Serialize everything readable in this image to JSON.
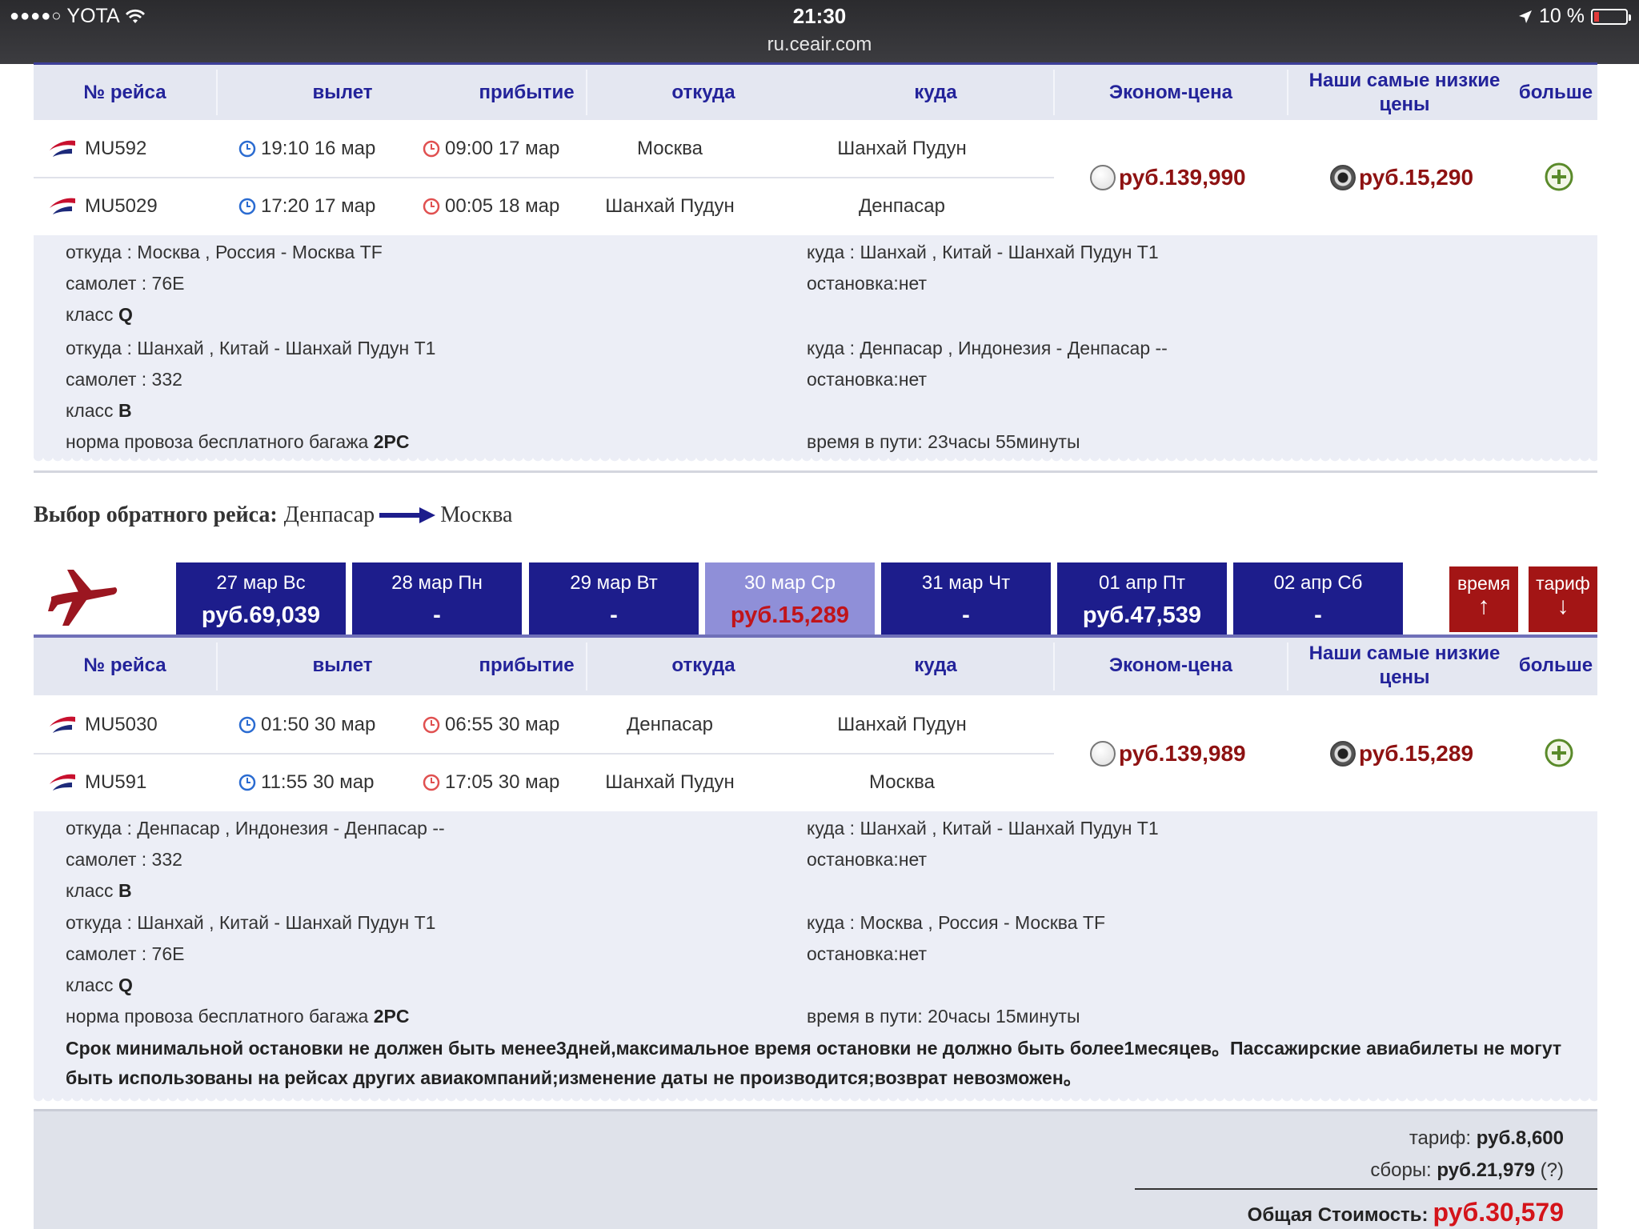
{
  "status": {
    "carrier": "YOTA",
    "time": "21:30",
    "url": "ru.ceair.com",
    "battery": "10 %"
  },
  "colors": {
    "accent": "#1d1d8c",
    "price_red": "#8e1212",
    "total_red": "#d4141a",
    "header_text": "#23239a"
  },
  "table_header": {
    "flight": "№ рейса",
    "depart": "вылет",
    "arrive": "прибытие",
    "from": "откуда",
    "to": "куда",
    "economy": "Эконом-цена",
    "lowest": "Наши самые низкие цены",
    "more": "больше"
  },
  "outbound": {
    "flights": [
      {
        "no": "MU592",
        "dep": "19:10 16 мар",
        "arr": "09:00 17 мар",
        "from": "Москва",
        "to": "Шанхай Пудун"
      },
      {
        "no": "MU5029",
        "dep": "17:20 17 мар",
        "arr": "00:05 18 мар",
        "from": "Шанхай Пудун",
        "to": "Денпасар"
      }
    ],
    "economy_price": "руб.139,990",
    "lowest_price": "руб.15,290",
    "details": {
      "l1": "откуда : Москва , Россия - Москва TF",
      "r1": "куда : Шанхай , Китай - Шанхай Пудун T1",
      "l2": "самолет : 76E",
      "r2": "остановка:нет",
      "l3": "класс",
      "l3v": "Q",
      "l4": "откуда : Шанхай , Китай - Шанхай Пудун T1",
      "r4": "куда : Денпасар , Индонезия - Денпасар --",
      "l5": "самолет : 332",
      "r5": "остановка:нет",
      "l6": "класс",
      "l6v": "B",
      "l7": "норма провоза бесплатного багажа",
      "l7v": "2PC",
      "r7": "время в пути: 23часы 55минуты"
    }
  },
  "return_title": {
    "label": "Выбор обратного рейса:",
    "from": "Денпасар",
    "to": "Москва"
  },
  "dates": [
    {
      "day": "27 мар Вс",
      "price": "руб.69,039"
    },
    {
      "day": "28 мар Пн",
      "price": "-"
    },
    {
      "day": "29 мар Вт",
      "price": "-"
    },
    {
      "day": "30 мар Ср",
      "price": "руб.15,289"
    },
    {
      "day": "31 мар Чт",
      "price": "-"
    },
    {
      "day": "01 апр Пт",
      "price": "руб.47,539"
    },
    {
      "day": "02 апр Сб",
      "price": "-"
    }
  ],
  "sort": {
    "time": "время",
    "time_arrow": "↑",
    "fare": "тариф",
    "fare_arrow": "↓"
  },
  "inbound": {
    "flights": [
      {
        "no": "MU5030",
        "dep": "01:50 30 мар",
        "arr": "06:55 30 мар",
        "from": "Денпасар",
        "to": "Шанхай Пудун"
      },
      {
        "no": "MU591",
        "dep": "11:55 30 мар",
        "arr": "17:05 30 мар",
        "from": "Шанхай Пудун",
        "to": "Москва"
      }
    ],
    "economy_price": "руб.139,989",
    "lowest_price": "руб.15,289",
    "details": {
      "l1": "откуда : Денпасар , Индонезия - Денпасар --",
      "r1": "куда : Шанхай , Китай - Шанхай Пудун T1",
      "l2": "самолет : 332",
      "r2": "остановка:нет",
      "l3": "класс",
      "l3v": "B",
      "l4": "откуда : Шанхай , Китай - Шанхай Пудун T1",
      "r4": "куда : Москва , Россия - Москва TF",
      "l5": "самолет : 76E",
      "r5": "остановка:нет",
      "l6": "класс",
      "l6v": "Q",
      "l7": "норма провоза бесплатного багажа",
      "l7v": "2PC",
      "r7": "время в пути: 20часы 15минуты"
    },
    "note": "Срок минимальной остановки не должен быть менее3дней,максимальное время остановки не должно быть более1месяцев。Пассажирские авиабилеты не могут быть использованы на рейсах других авиакомпаний;изменение даты не производится;возврат невозможен。"
  },
  "summary": {
    "fare_label": "тариф:",
    "fare_value": "руб.8,600",
    "fees_label": "сборы:",
    "fees_value": "руб.21,979",
    "fees_help": "(?)",
    "total_label": "Общая Стоимость:",
    "total_value": "руб.30,579"
  }
}
